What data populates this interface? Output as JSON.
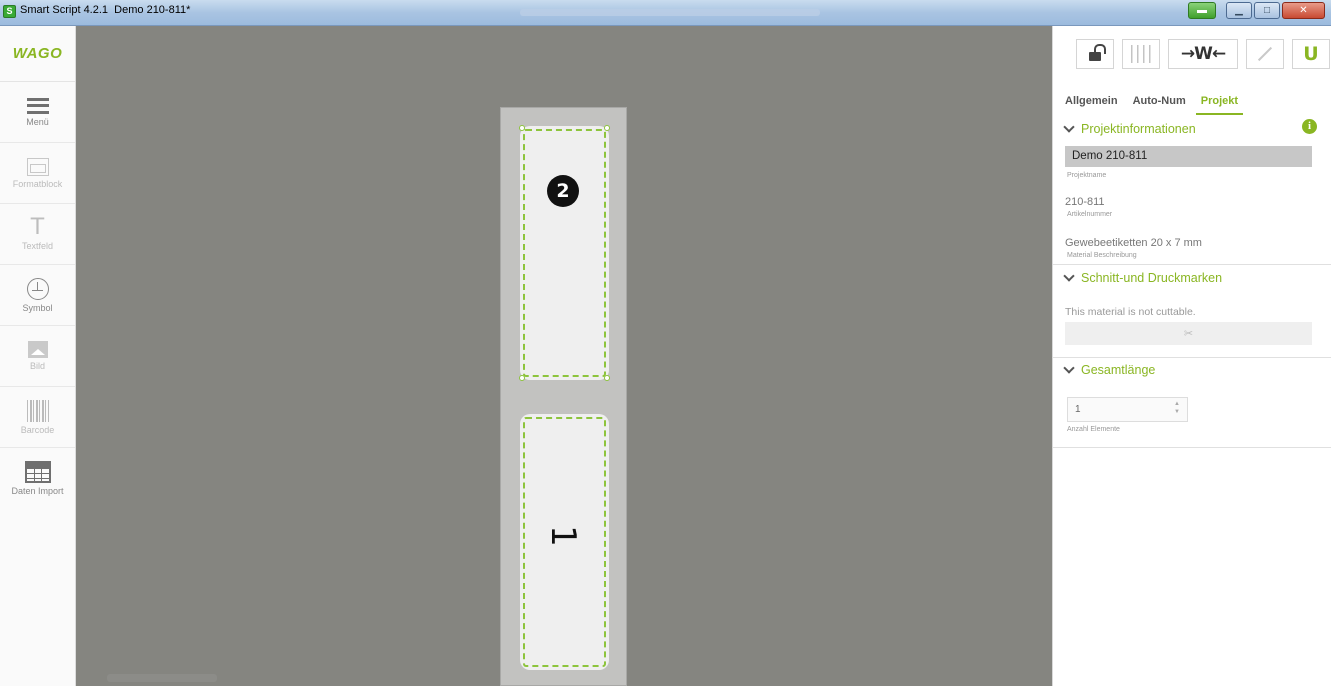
{
  "window": {
    "app_title": "Smart Script 4.2.1",
    "document_title": "Demo 210-811*"
  },
  "sidebar": {
    "logo": "WAGO",
    "items": [
      {
        "label": "Menü",
        "icon": "menu-icon",
        "enabled": true
      },
      {
        "label": "Formatblock",
        "icon": "format-block-icon",
        "enabled": false
      },
      {
        "label": "Textfeld",
        "icon": "text-field-icon",
        "enabled": false
      },
      {
        "label": "Symbol",
        "icon": "ground-symbol-icon",
        "enabled": true
      },
      {
        "label": "Bild",
        "icon": "image-icon",
        "enabled": false
      },
      {
        "label": "Barcode",
        "icon": "barcode-icon",
        "enabled": false
      },
      {
        "label": "Daten Import",
        "icon": "table-import-icon",
        "enabled": true
      }
    ]
  },
  "canvas": {
    "labels": [
      {
        "badge": "2"
      },
      {
        "text": "1"
      }
    ]
  },
  "panel": {
    "toolbar": {
      "lock": "lock-icon",
      "bars": "bars-icon",
      "weight": "→W←",
      "wand": "wand-icon",
      "magnet": "U"
    },
    "tabs": [
      "Allgemein",
      "Auto-Num",
      "Projekt"
    ],
    "active_tab": "Projekt",
    "projektinfo": {
      "heading": "Projektinformationen",
      "project_name": "Demo 210-811",
      "project_name_caption": "Projektname",
      "article_number": "210-811",
      "article_number_caption": "Artikelnummer",
      "material": "Gewebeetiketten  20 x 7 mm",
      "material_caption": "Material Beschreibung"
    },
    "schnitt": {
      "heading": "Schnitt-und Druckmarken",
      "message": "This material is not cuttable.",
      "button_icon": "✂"
    },
    "gesamt": {
      "heading": "Gesamtlänge",
      "count": "1",
      "count_caption": "Anzahl Elemente"
    },
    "accent": "#8ab623"
  }
}
